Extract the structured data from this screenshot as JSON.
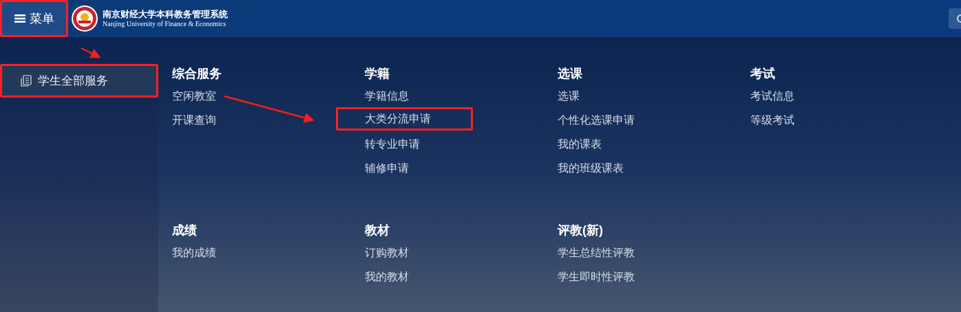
{
  "header": {
    "menu_button": {
      "label": "菜单",
      "highlighted": true
    },
    "title": "南京财经大学本科教务管理系统",
    "subtitle": "Nanjing University of Finance & Economics"
  },
  "sidebar": {
    "items": [
      {
        "label": "学生全部服务",
        "selected": true,
        "highlighted": true
      }
    ]
  },
  "sections": [
    {
      "title": "综合服务",
      "items": [
        {
          "label": "空闲教室",
          "highlighted": false
        },
        {
          "label": "开课查询",
          "highlighted": false
        }
      ]
    },
    {
      "title": "学籍",
      "items": [
        {
          "label": "学籍信息",
          "highlighted": false
        },
        {
          "label": "大类分流申请",
          "highlighted": true
        },
        {
          "label": "转专业申请",
          "highlighted": false
        },
        {
          "label": "辅修申请",
          "highlighted": false
        }
      ]
    },
    {
      "title": "选课",
      "items": [
        {
          "label": "选课",
          "highlighted": false
        },
        {
          "label": "个性化选课申请",
          "highlighted": false
        },
        {
          "label": "我的课表",
          "highlighted": false
        },
        {
          "label": "我的班级课表",
          "highlighted": false
        }
      ]
    },
    {
      "title": "考试",
      "items": [
        {
          "label": "考试信息",
          "highlighted": false
        },
        {
          "label": "等级考试",
          "highlighted": false
        }
      ]
    },
    {
      "title": "成绩",
      "items": [
        {
          "label": "我的成绩",
          "highlighted": false
        }
      ]
    },
    {
      "title": "教材",
      "items": [
        {
          "label": "订购教材",
          "highlighted": false
        },
        {
          "label": "我的教材",
          "highlighted": false
        }
      ]
    },
    {
      "title": "评教(新)",
      "items": [
        {
          "label": "学生总结性评教",
          "highlighted": false
        },
        {
          "label": "学生即时性评教",
          "highlighted": false
        }
      ]
    }
  ]
}
